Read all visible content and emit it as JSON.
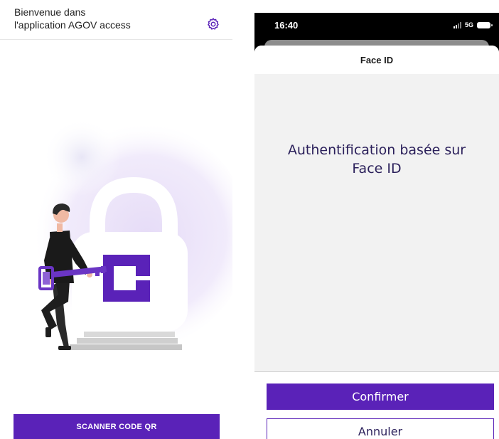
{
  "left_screen": {
    "welcome_line1": "Bienvenue dans",
    "welcome_line2": "l'application AGOV access",
    "settings_icon": "gear-icon",
    "scan_button_label": "SCANNER CODE QR",
    "illustration": "person-holding-key-beside-padlock",
    "colors": {
      "accent": "#5a22b8",
      "glow": "#efe8fb",
      "padlock": "#ffffff",
      "steps": "#c6c6c6"
    }
  },
  "right_screen": {
    "status_bar": {
      "time": "16:40",
      "network": "5G",
      "signal_icon": "signal-bars-icon",
      "battery_icon": "battery-icon"
    },
    "sheet": {
      "title": "Face ID",
      "message_line1": "Authentification basée sur",
      "message_line2": "Face ID",
      "confirm_label": "Confirmer",
      "cancel_label": "Annuler"
    },
    "colors": {
      "accent": "#5a22b8",
      "text": "#2a1f5a",
      "content_bg": "#f2f2f2"
    }
  }
}
